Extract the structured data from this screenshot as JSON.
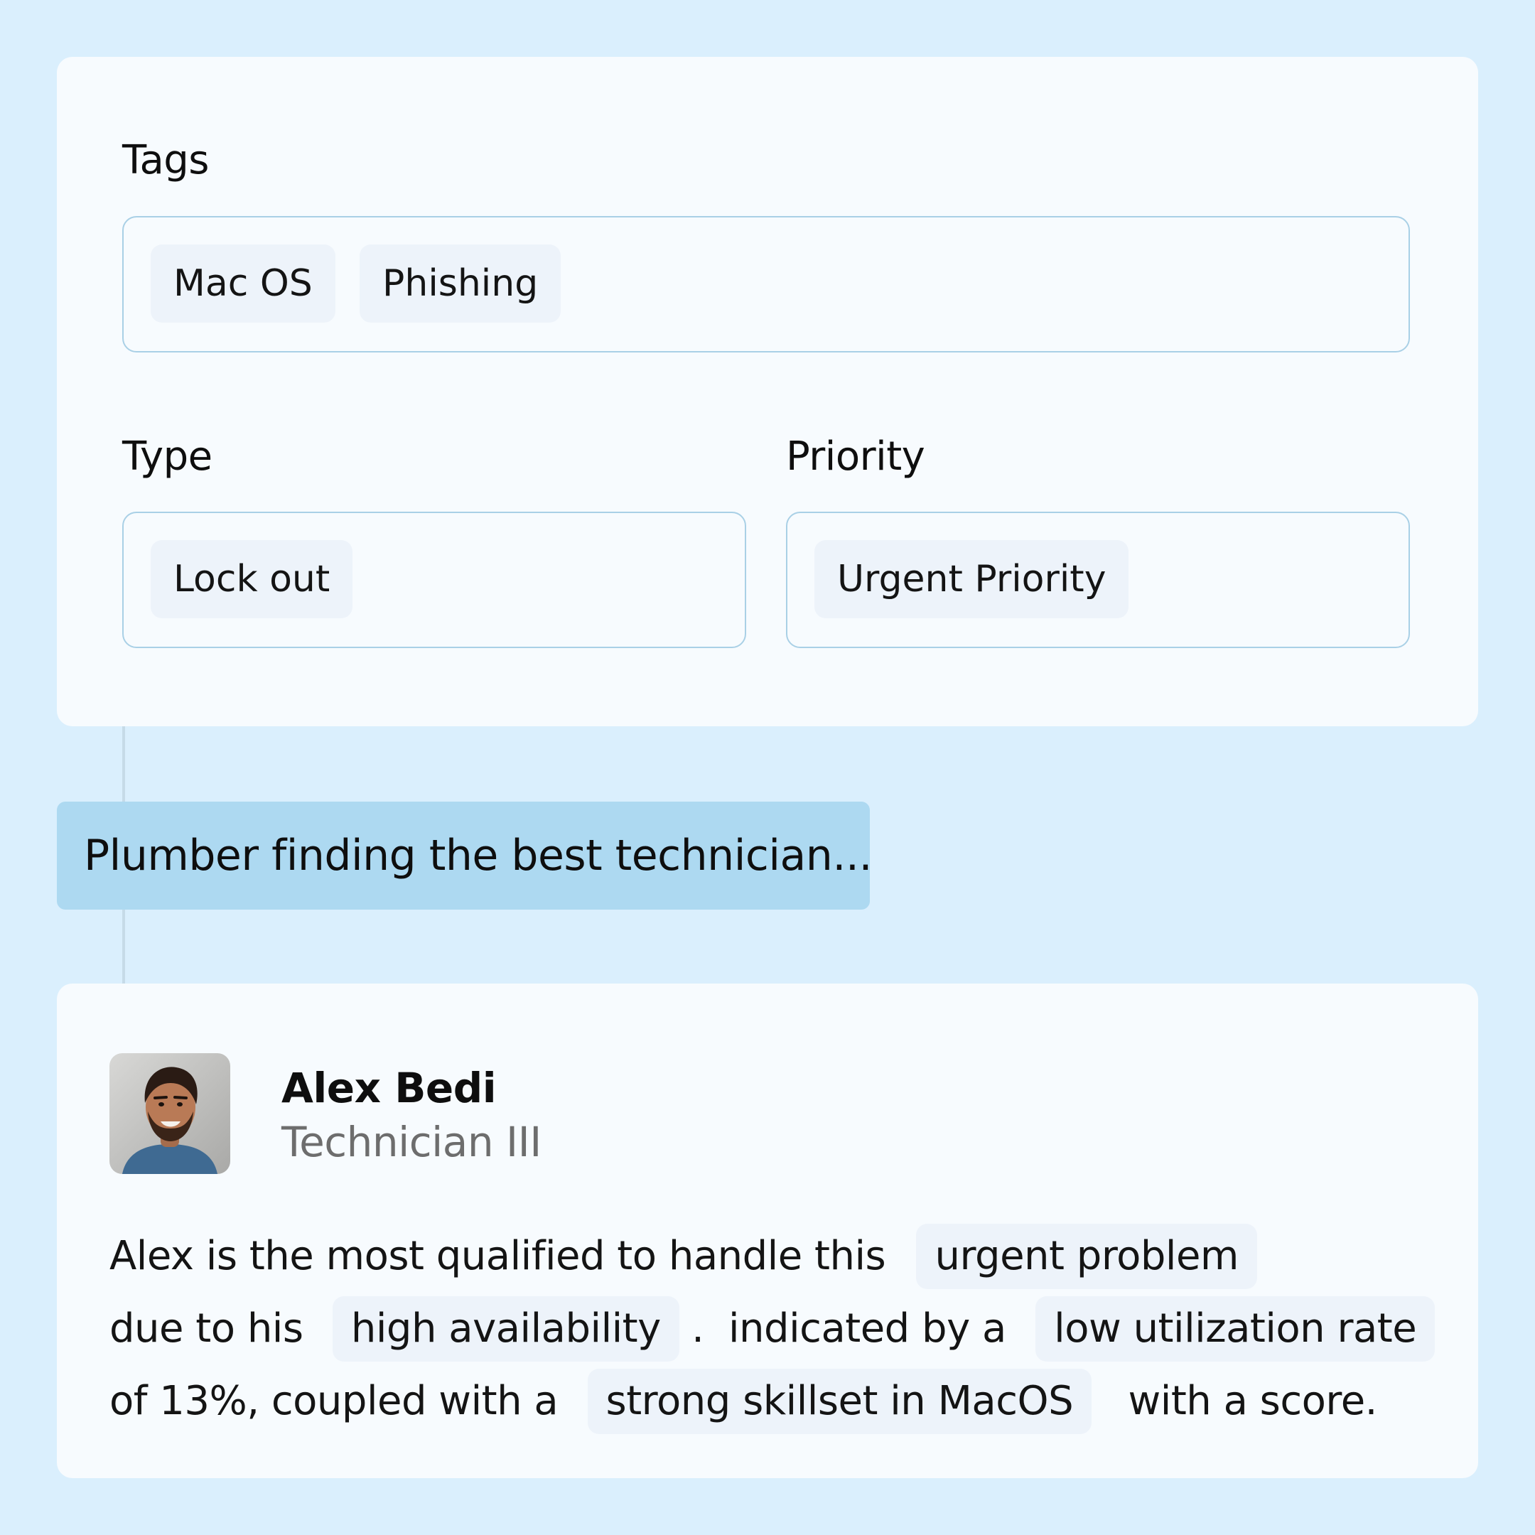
{
  "ticket": {
    "tags": {
      "label": "Tags",
      "values": [
        "Mac OS",
        "Phishing"
      ]
    },
    "type": {
      "label": "Type",
      "value": "Lock out"
    },
    "priority": {
      "label": "Priority",
      "value": "Urgent Priority"
    }
  },
  "status": {
    "message": "Plumber finding the best technician..."
  },
  "technician": {
    "name": "Alex Bedi",
    "role": "Technician III",
    "avatar_icon": "person-photo",
    "reason": {
      "line1_text": "Alex is the most qualified to handle this",
      "line1_highlight": "urgent problem",
      "line2_text_a": "due to his",
      "line2_highlight_a": "high availability",
      "line2_text_b": ".  indicated by a",
      "line2_highlight_b": "low utilization rate",
      "line3_text_a": "of 13%, coupled with a",
      "line3_highlight": "strong skillset in MacOS",
      "line3_text_b": "with a score."
    }
  },
  "colors": {
    "background": "#daeffd",
    "card": "#f7fbfe",
    "chip": "#edf3fa",
    "field_border": "#a9d0e6",
    "banner": "#add9f1",
    "muted_text": "#6d6d6d"
  }
}
